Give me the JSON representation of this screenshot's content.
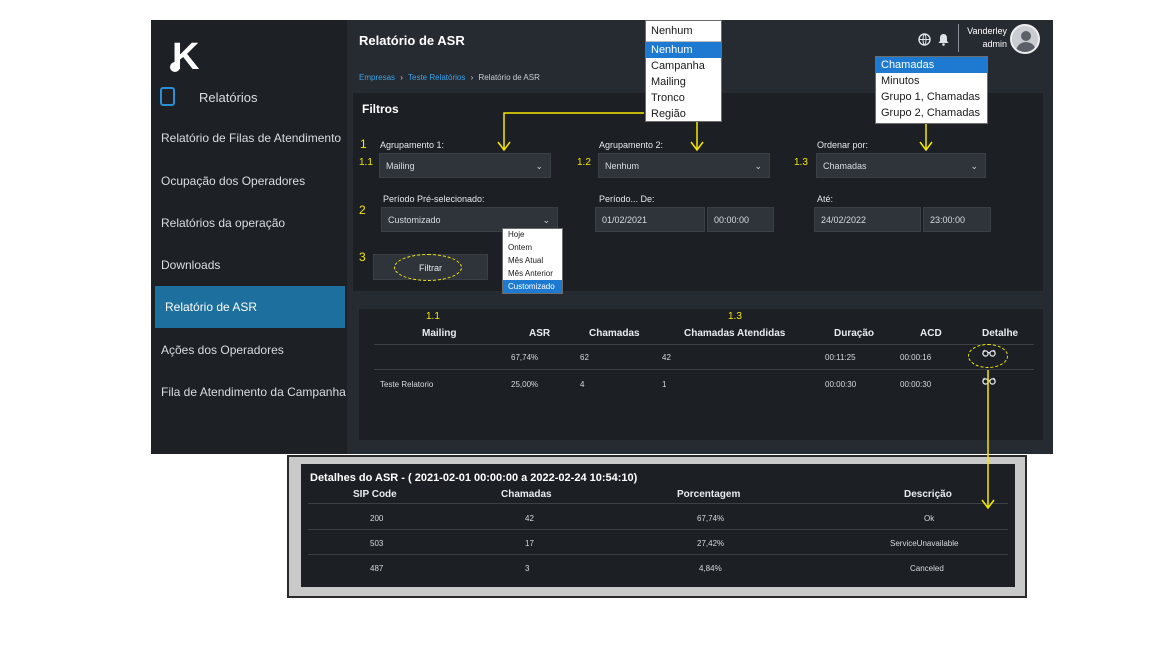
{
  "sidebar": {
    "logo": "K",
    "section_title": "Relatórios",
    "items": [
      {
        "label": "Relatório de Filas de Atendimento"
      },
      {
        "label": "Ocupação dos Operadores"
      },
      {
        "label": "Relatórios da operação"
      },
      {
        "label": "Downloads"
      },
      {
        "label": "Relatório de ASR",
        "active": true
      },
      {
        "label": "Ações dos Operadores"
      },
      {
        "label": "Fila de Atendimento da Campanha"
      }
    ]
  },
  "header": {
    "title": "Relatório de ASR",
    "user_name": "Vanderley",
    "user_role": "admin",
    "icons": [
      "globe-icon",
      "bell-icon",
      "avatar"
    ]
  },
  "breadcrumb": {
    "items": [
      "Empresas",
      "Teste Relatórios",
      "Relatório de ASR"
    ],
    "separator": "›"
  },
  "filters": {
    "title": "Filtros",
    "group1": {
      "label": "Agrupamento 1:",
      "value": "Mailing"
    },
    "group2": {
      "label": "Agrupamento 2:",
      "value": "Nenhum"
    },
    "order": {
      "label": "Ordenar por:",
      "value": "Chamadas"
    },
    "period_preset": {
      "label": "Período Pré-selecionado:",
      "value": "Customizado"
    },
    "period_from": {
      "label": "Período... De:",
      "date": "01/02/2021",
      "time": "00:00:00"
    },
    "period_to": {
      "label": "Até:",
      "date": "24/02/2022",
      "time": "23:00:00"
    },
    "filter_button": "Filtrar"
  },
  "dropdowns": {
    "group_dd": {
      "current": "Nenhum",
      "options": [
        "Nenhum",
        "Campanha",
        "Mailing",
        "Tronco",
        "Região"
      ],
      "selected": 0
    },
    "order_dd": {
      "options": [
        "Chamadas",
        "Minutos",
        "Grupo 1, Chamadas",
        "Grupo 2, Chamadas"
      ],
      "selected": 0
    },
    "period_dd": {
      "options": [
        "Hoje",
        "Ontem",
        "Mês Atual",
        "Mês Anterior",
        "Customizado"
      ],
      "selected": 4
    }
  },
  "annotations": {
    "n1": "1",
    "n1_1": "1.1",
    "n1_2": "1.2",
    "n1_3": "1.3",
    "n2": "2",
    "n3": "3",
    "r1_1": "1.1",
    "r1_3": "1.3",
    "color": "#f5e800"
  },
  "results": {
    "columns": [
      "Mailing",
      "ASR",
      "Chamadas",
      "Chamadas Atendidas",
      "Duração",
      "ACD",
      "Detalhe"
    ],
    "rows": [
      [
        "",
        "67,74%",
        "62",
        "42",
        "00:11:25",
        "00:00:16"
      ],
      [
        "Teste Relatorio",
        "25,00%",
        "4",
        "1",
        "00:00:30",
        "00:00:30"
      ]
    ],
    "detail_icon": "glasses-icon"
  },
  "asr_detail": {
    "title": "Detalhes do ASR - ( 2021-02-01 00:00:00 a 2022-02-24 10:54:10)",
    "columns": [
      "SIP Code",
      "Chamadas",
      "Porcentagem",
      "Descrição"
    ],
    "rows": [
      [
        "200",
        "42",
        "67,74%",
        "Ok"
      ],
      [
        "503",
        "17",
        "27,42%",
        "ServiceUnavailable"
      ],
      [
        "487",
        "3",
        "4,84%",
        "Canceled"
      ]
    ]
  },
  "colors": {
    "accent": "#1d6f9e",
    "link": "#3ba3e8",
    "annotation": "#f5e800",
    "dropdown_selected": "#1e7ad0"
  }
}
